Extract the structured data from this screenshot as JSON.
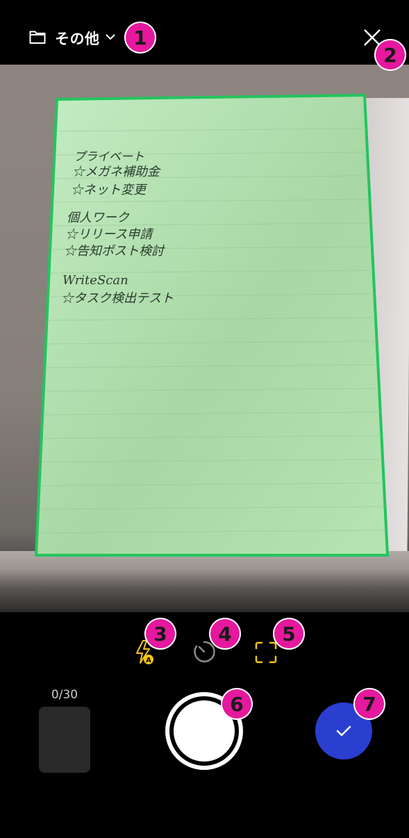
{
  "header": {
    "folder_label": "その他",
    "folder_icon": "folder-icon",
    "chevron_icon": "chevron-down-icon",
    "close_icon": "close-icon"
  },
  "document": {
    "lines": [
      "プライベート",
      "☆メガネ補助金",
      "☆ネット変更",
      "個人ワーク",
      "☆リリース申請",
      "☆告知ポスト検討",
      "WriteScan",
      "☆タスク検出テスト"
    ]
  },
  "controls": {
    "flash_icon": "flash-auto-icon",
    "timer_icon": "timer-icon",
    "crop_icon": "document-detect-icon",
    "flash_color": "#f5c518",
    "crop_color": "#f5c518"
  },
  "capture": {
    "counter": "0/30",
    "done_color": "#2a3fd0"
  },
  "badges": {
    "b1": "1",
    "b2": "2",
    "b3": "3",
    "b4": "4",
    "b5": "5",
    "b6": "6",
    "b7": "7",
    "badge_color": "#e6189d"
  },
  "detection": {
    "outline_color": "#22c55e",
    "fill_color": "#b9e8b9"
  }
}
